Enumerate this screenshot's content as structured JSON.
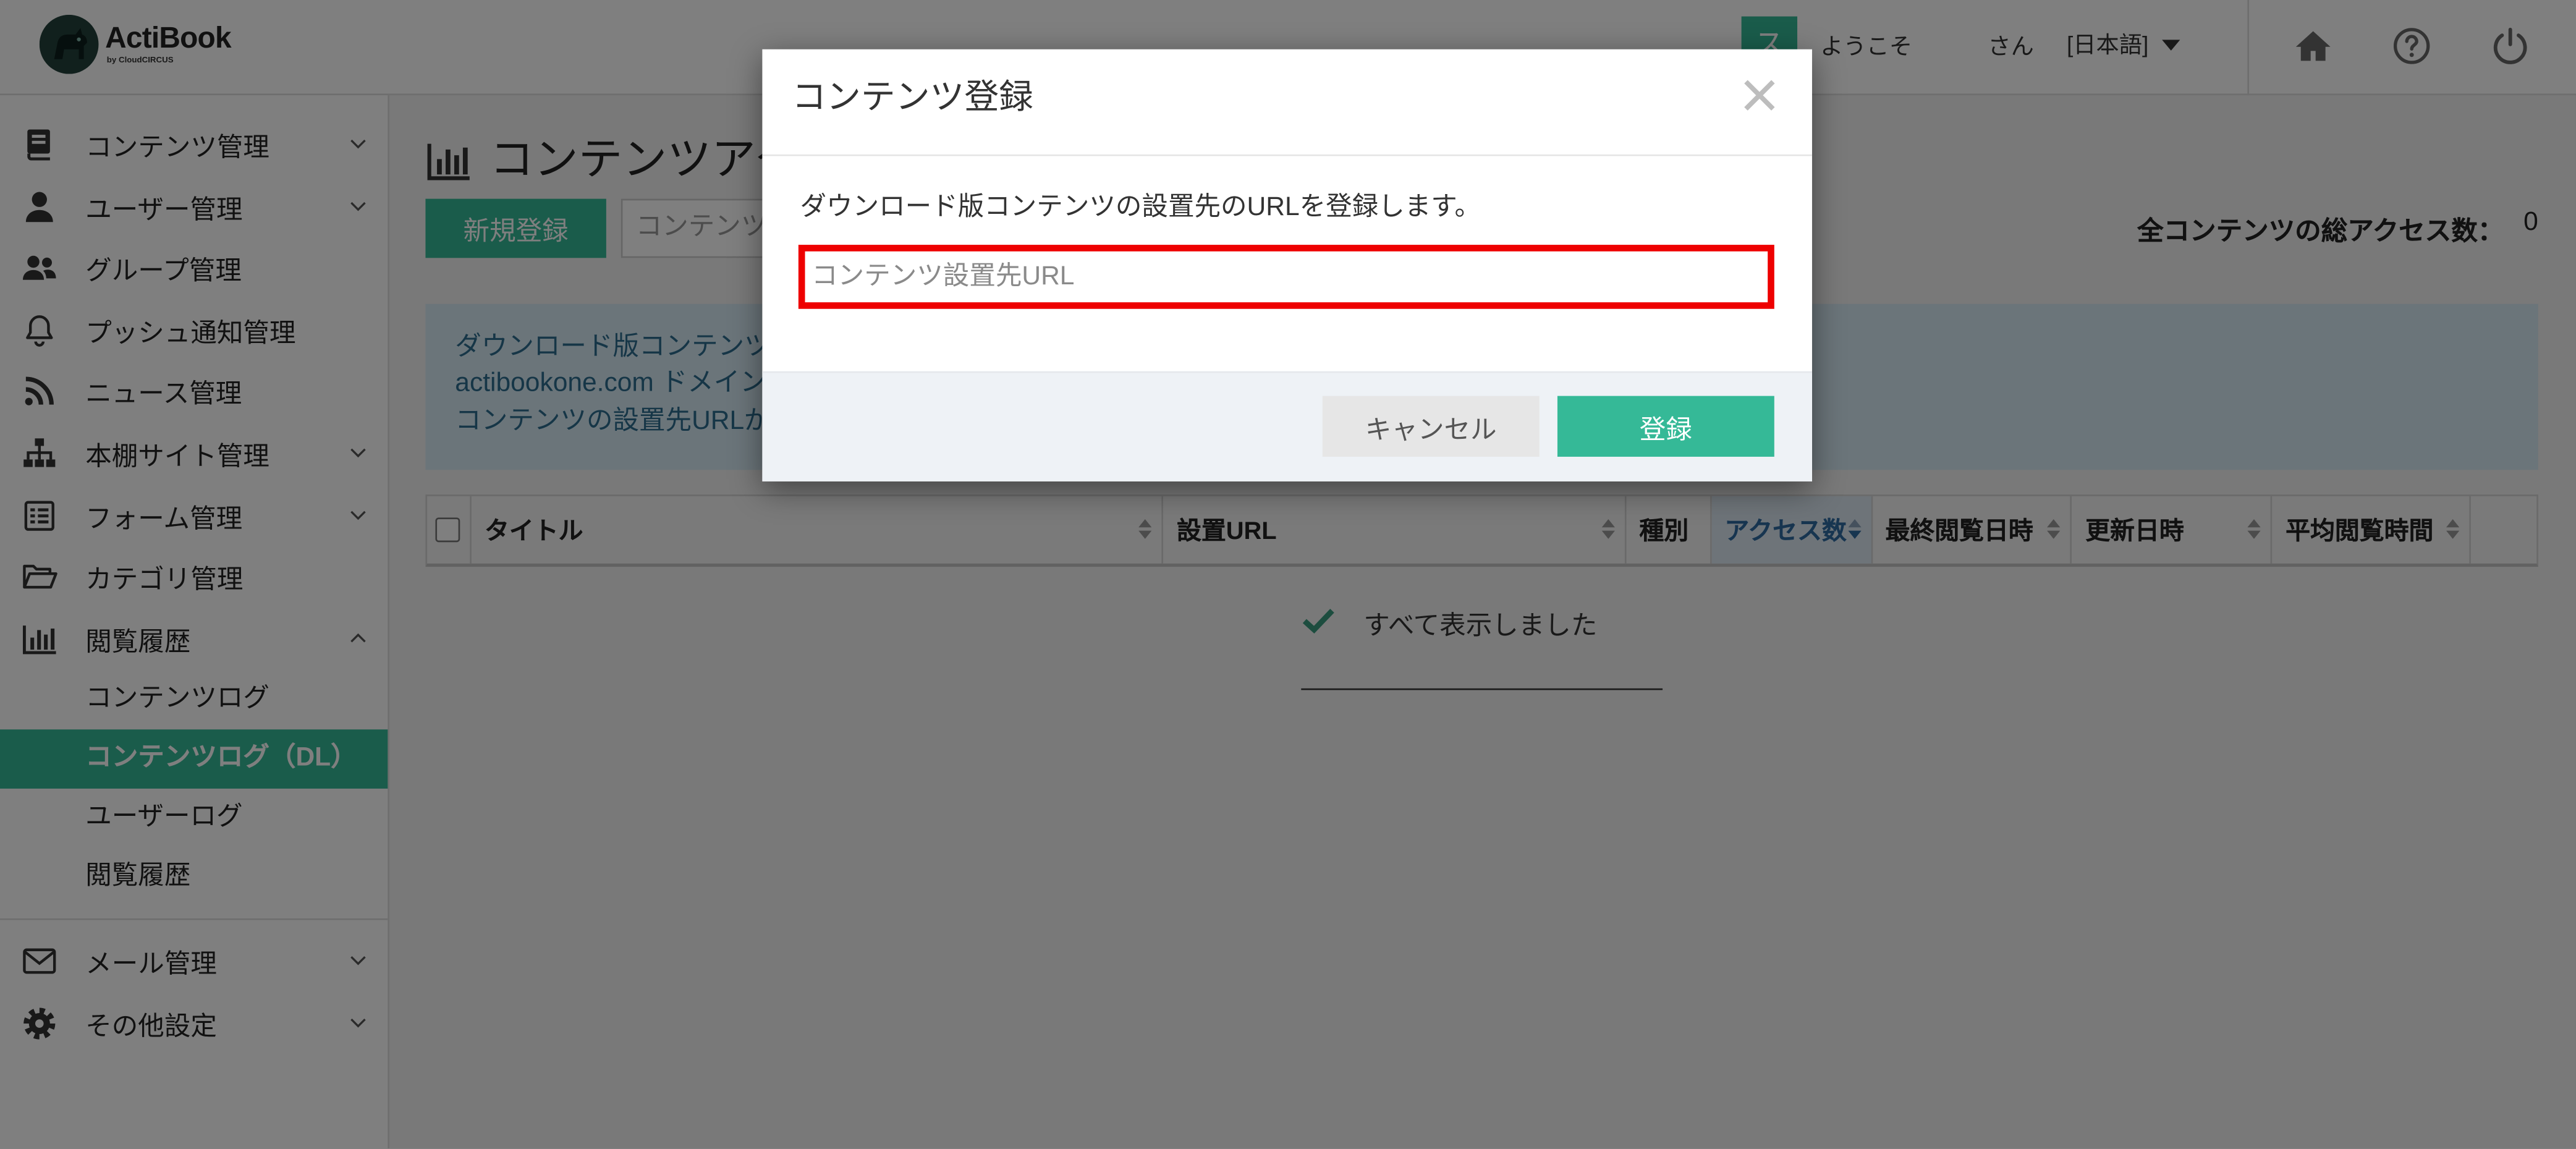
{
  "app": {
    "brand": "ActiBook",
    "brand_sub": "by CloudCIRCUS",
    "logo_icon": "mascot-logo-icon",
    "accent_color": "#35b997"
  },
  "header": {
    "avatar_initial": "ス",
    "welcome": "ようこそ",
    "honorific": "さん",
    "language": "[日本語]",
    "icons": [
      "home-icon",
      "help-icon",
      "power-icon"
    ]
  },
  "sidebar": {
    "items": [
      {
        "label": "コンテンツ管理",
        "icon": "book-icon",
        "chevron": "down"
      },
      {
        "label": "ユーザー管理",
        "icon": "user-icon",
        "chevron": "down"
      },
      {
        "label": "グループ管理",
        "icon": "users-icon",
        "chevron": ""
      },
      {
        "label": "プッシュ通知管理",
        "icon": "bell-icon",
        "chevron": ""
      },
      {
        "label": "ニュース管理",
        "icon": "rss-icon",
        "chevron": ""
      },
      {
        "label": "本棚サイト管理",
        "icon": "sitemap-icon",
        "chevron": "down"
      },
      {
        "label": "フォーム管理",
        "icon": "form-icon",
        "chevron": "down"
      },
      {
        "label": "カテゴリ管理",
        "icon": "folder-open-icon",
        "chevron": ""
      },
      {
        "label": "閲覧履歴",
        "icon": "bar-chart-icon",
        "chevron": "up"
      }
    ],
    "log_items": [
      {
        "label": "コンテンツログ",
        "active": false
      },
      {
        "label": "コンテンツログ（DL）",
        "active": true
      },
      {
        "label": "ユーザーログ",
        "active": false
      },
      {
        "label": "閲覧履歴",
        "active": false
      }
    ],
    "bottom_items": [
      {
        "label": "メール管理",
        "icon": "envelope-icon",
        "chevron": "down"
      },
      {
        "label": "その他設定",
        "icon": "gear-icon",
        "chevron": "down"
      }
    ]
  },
  "main": {
    "page_title": "コンテンツアク",
    "page_title_icon": "bar-chart-icon",
    "new_button": "新規登録",
    "search_placeholder": "コンテンツ",
    "total_access_label": "全コンテンツの総アクセス数：",
    "total_access_value": "0",
    "info_lines": [
      "ダウンロード版コンテンツ",
      "actibookone.com ドメイン",
      "コンテンツの設置先URLが"
    ],
    "table": {
      "columns": [
        {
          "label": "タイトル",
          "sortable": true
        },
        {
          "label": "設置URL",
          "sortable": true
        },
        {
          "label": "種別",
          "sortable": false
        },
        {
          "label": "アクセス数",
          "sortable": true,
          "sorted": true
        },
        {
          "label": "最終閲覧日時",
          "sortable": true
        },
        {
          "label": "更新日時",
          "sortable": true
        },
        {
          "label": "平均閲覧時間",
          "sortable": true
        }
      ],
      "empty_icon": "check-icon",
      "empty_message": "すべて表示しました"
    }
  },
  "modal": {
    "title": "コンテンツ登録",
    "close_icon": "close-icon",
    "description": "ダウンロード版コンテンツの設置先のURLを登録します。",
    "url_value": "",
    "url_placeholder": "コンテンツ設置先URL",
    "highlight_color": "#ee0000",
    "cancel_label": "キャンセル",
    "submit_label": "登録"
  }
}
